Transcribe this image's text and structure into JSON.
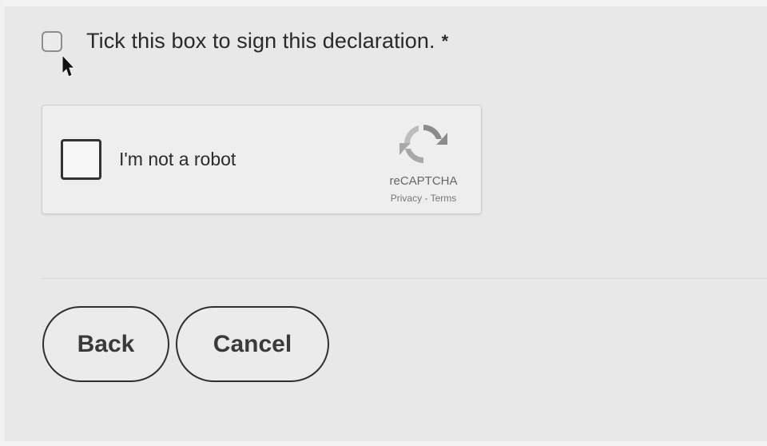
{
  "declaration": {
    "label": "Tick this box to sign this declaration.",
    "required_marker": "*",
    "checked": false
  },
  "recaptcha": {
    "label": "I'm not a robot",
    "brand": "reCAPTCHA",
    "privacy_link": "Privacy",
    "separator": "-",
    "terms_link": "Terms",
    "checked": false
  },
  "actions": {
    "back_label": "Back",
    "cancel_label": "Cancel"
  },
  "icons": {
    "cursor": "mouse-pointer-icon",
    "recaptcha_logo": "recaptcha-logo-icon"
  },
  "colors": {
    "background": "#e8e8e8",
    "button_border": "#2f2f2f",
    "text": "#2a2a2a"
  }
}
